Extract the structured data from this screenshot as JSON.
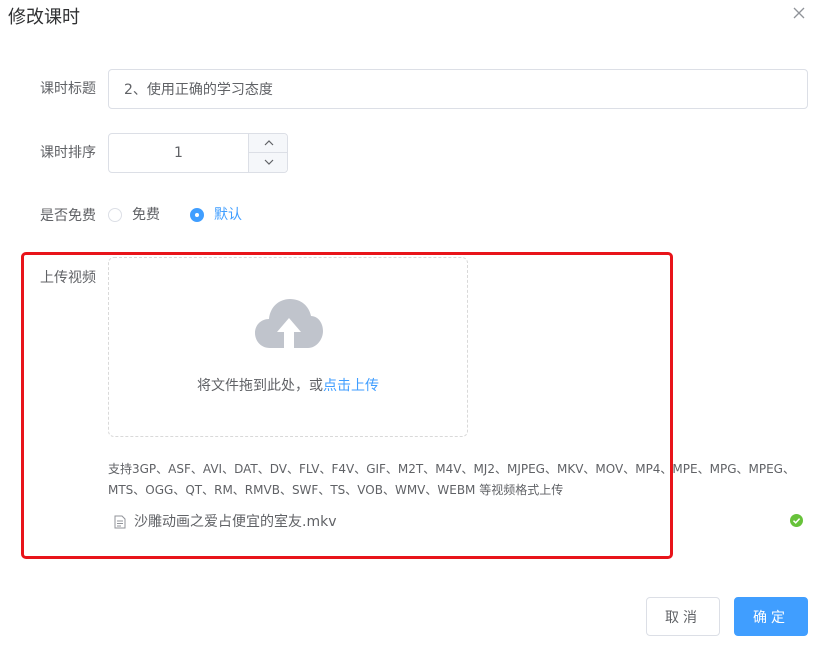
{
  "dialog": {
    "title": "修改课时"
  },
  "form": {
    "title_label": "课时标题",
    "title_value": "2、使用正确的学习态度",
    "order_label": "课时排序",
    "order_value": "1",
    "free_label": "是否免费",
    "free_options": [
      {
        "label": "免费",
        "checked": false
      },
      {
        "label": "默认",
        "checked": true
      }
    ],
    "video_label": "上传视频"
  },
  "upload": {
    "icon": "upload-cloud-icon",
    "drop_text": "将文件拖到此处，或",
    "drop_link": "点击上传",
    "tip": "支持3GP、ASF、AVI、DAT、DV、FLV、F4V、GIF、M2T、M4V、MJ2、MJPEG、MKV、MOV、MP4、MPE、MPG、MPEG、MTS、OGG、QT、RM、RMVB、SWF、TS、VOB、WMV、WEBM 等视频格式上传",
    "files": [
      {
        "name": "沙雕动画之爱占便宜的室友.mkv",
        "status": "success"
      }
    ]
  },
  "footer": {
    "cancel_label": "取消",
    "confirm_label": "确定"
  },
  "colors": {
    "primary": "#409eff",
    "success": "#67c23a",
    "highlight": "#e8141a"
  }
}
